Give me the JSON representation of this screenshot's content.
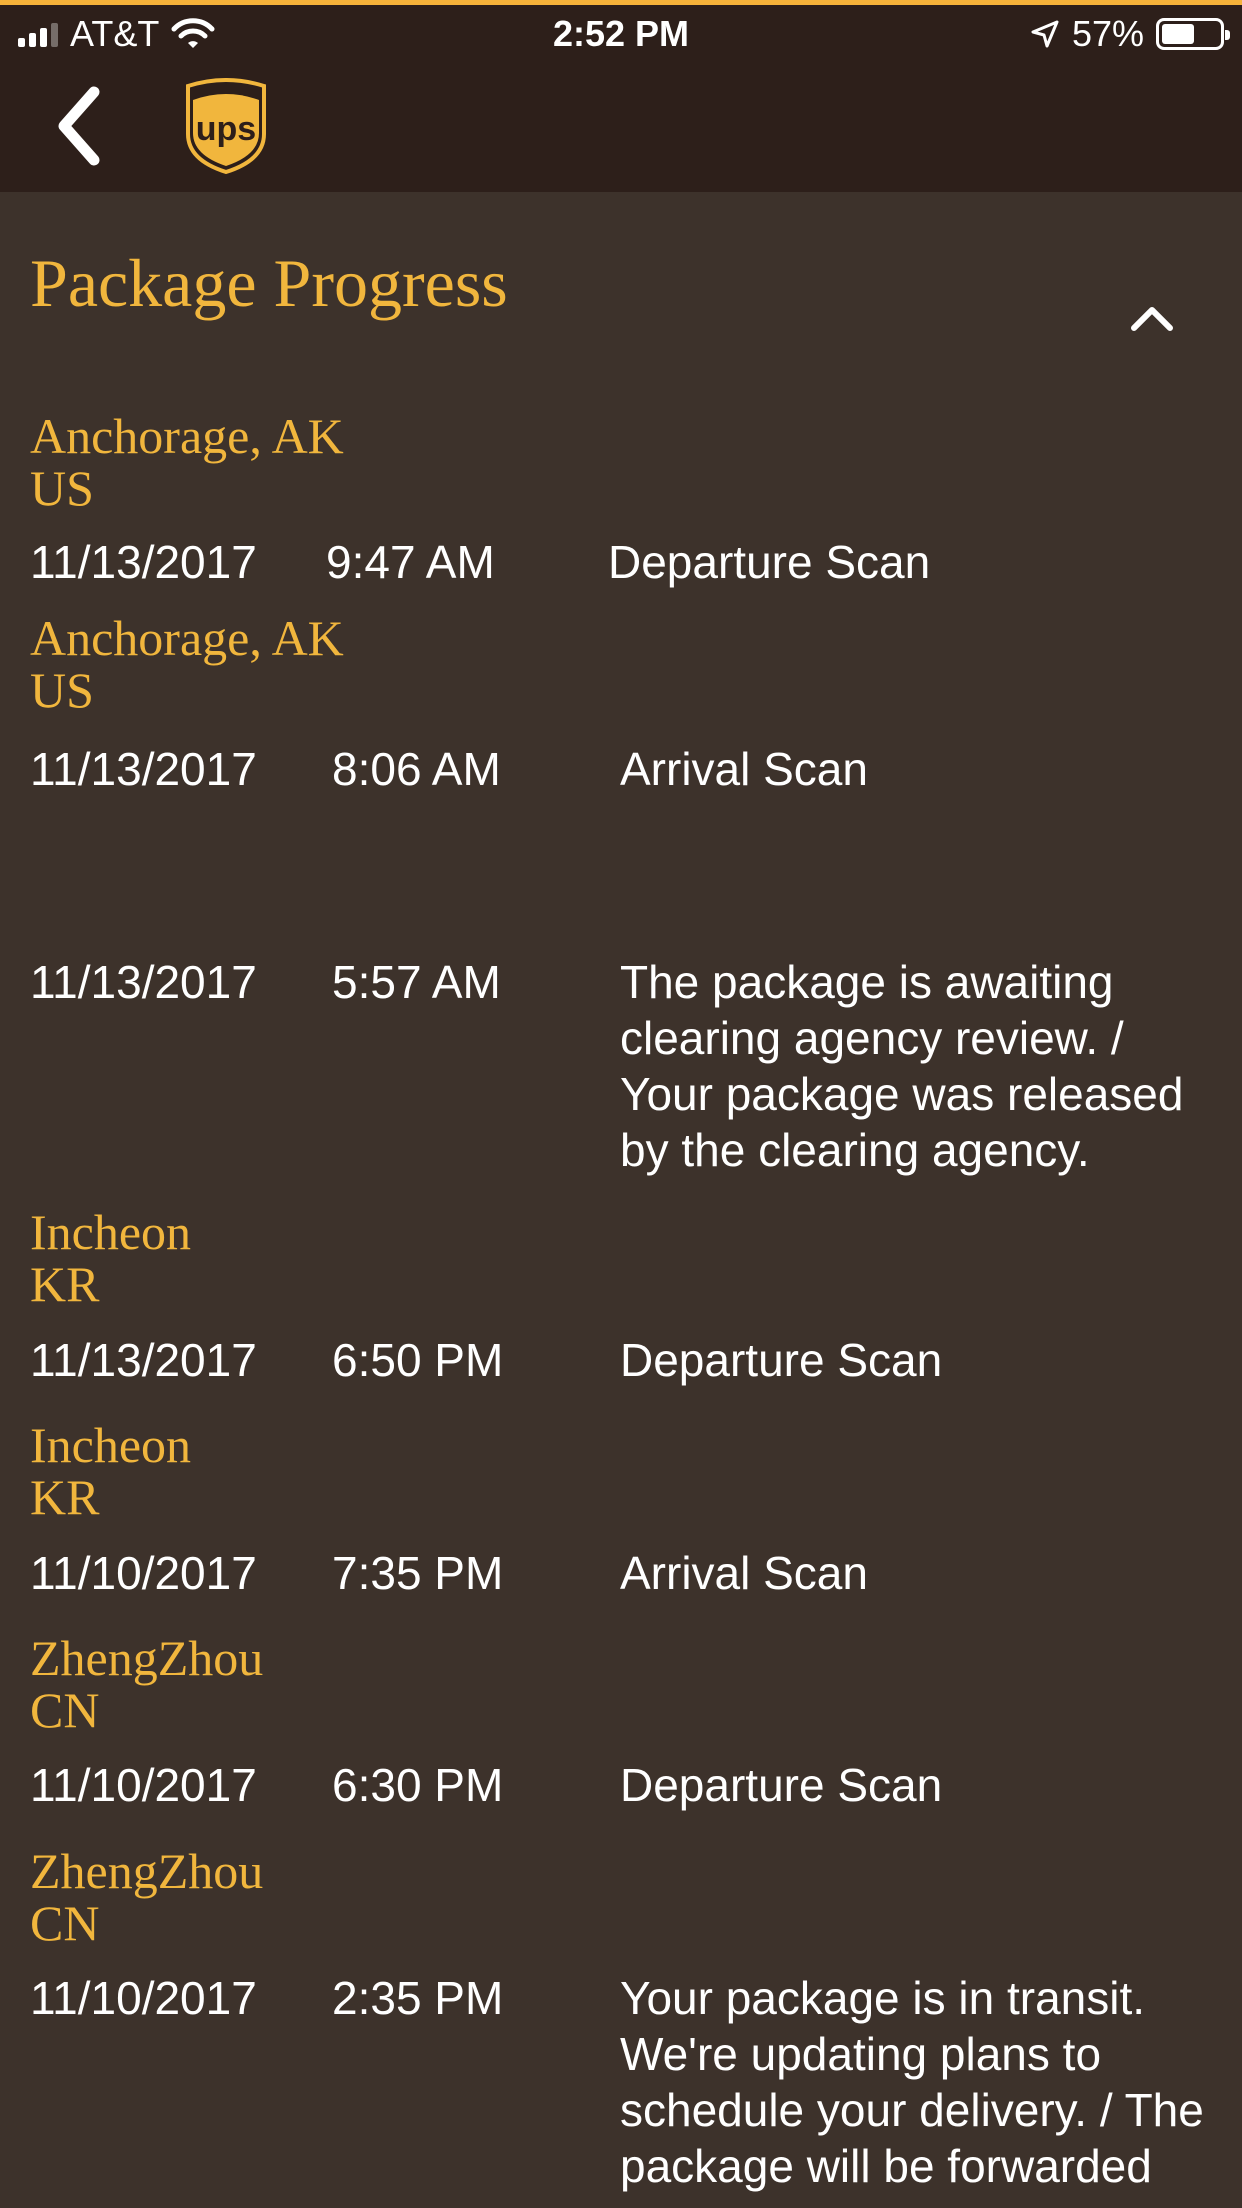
{
  "status_bar": {
    "carrier": "AT&T",
    "time": "2:52 PM",
    "battery": "57%",
    "battery_level": 0.57
  },
  "header": {
    "logo_text": "ups"
  },
  "section": {
    "title": "Package Progress"
  },
  "events": [
    {
      "location": "Anchorage, AK",
      "country": "US",
      "date": "11/13/2017",
      "time": "9:47 AM",
      "activity": "Departure Scan"
    },
    {
      "location": "Anchorage, AK",
      "country": "US",
      "date": "11/13/2017",
      "time": "8:06 AM",
      "activity": "Arrival Scan"
    },
    {
      "location": "",
      "country": "",
      "date": "11/13/2017",
      "time": "5:57 AM",
      "activity": "The package is awaiting clearing agency review. / Your package was released by the clearing agency."
    },
    {
      "location": "Incheon",
      "country": "KR",
      "date": "11/13/2017",
      "time": "6:50 PM",
      "activity": "Departure Scan"
    },
    {
      "location": "Incheon",
      "country": "KR",
      "date": "11/10/2017",
      "time": "7:35 PM",
      "activity": "Arrival Scan"
    },
    {
      "location": "ZhengZhou",
      "country": "CN",
      "date": "11/10/2017",
      "time": "6:30 PM",
      "activity": "Departure Scan"
    },
    {
      "location": "ZhengZhou",
      "country": "CN",
      "date": "11/10/2017",
      "time": "2:35 PM",
      "activity": "Your package is in transit. We're updating plans to schedule your delivery. / The package will be forwarded"
    }
  ]
}
